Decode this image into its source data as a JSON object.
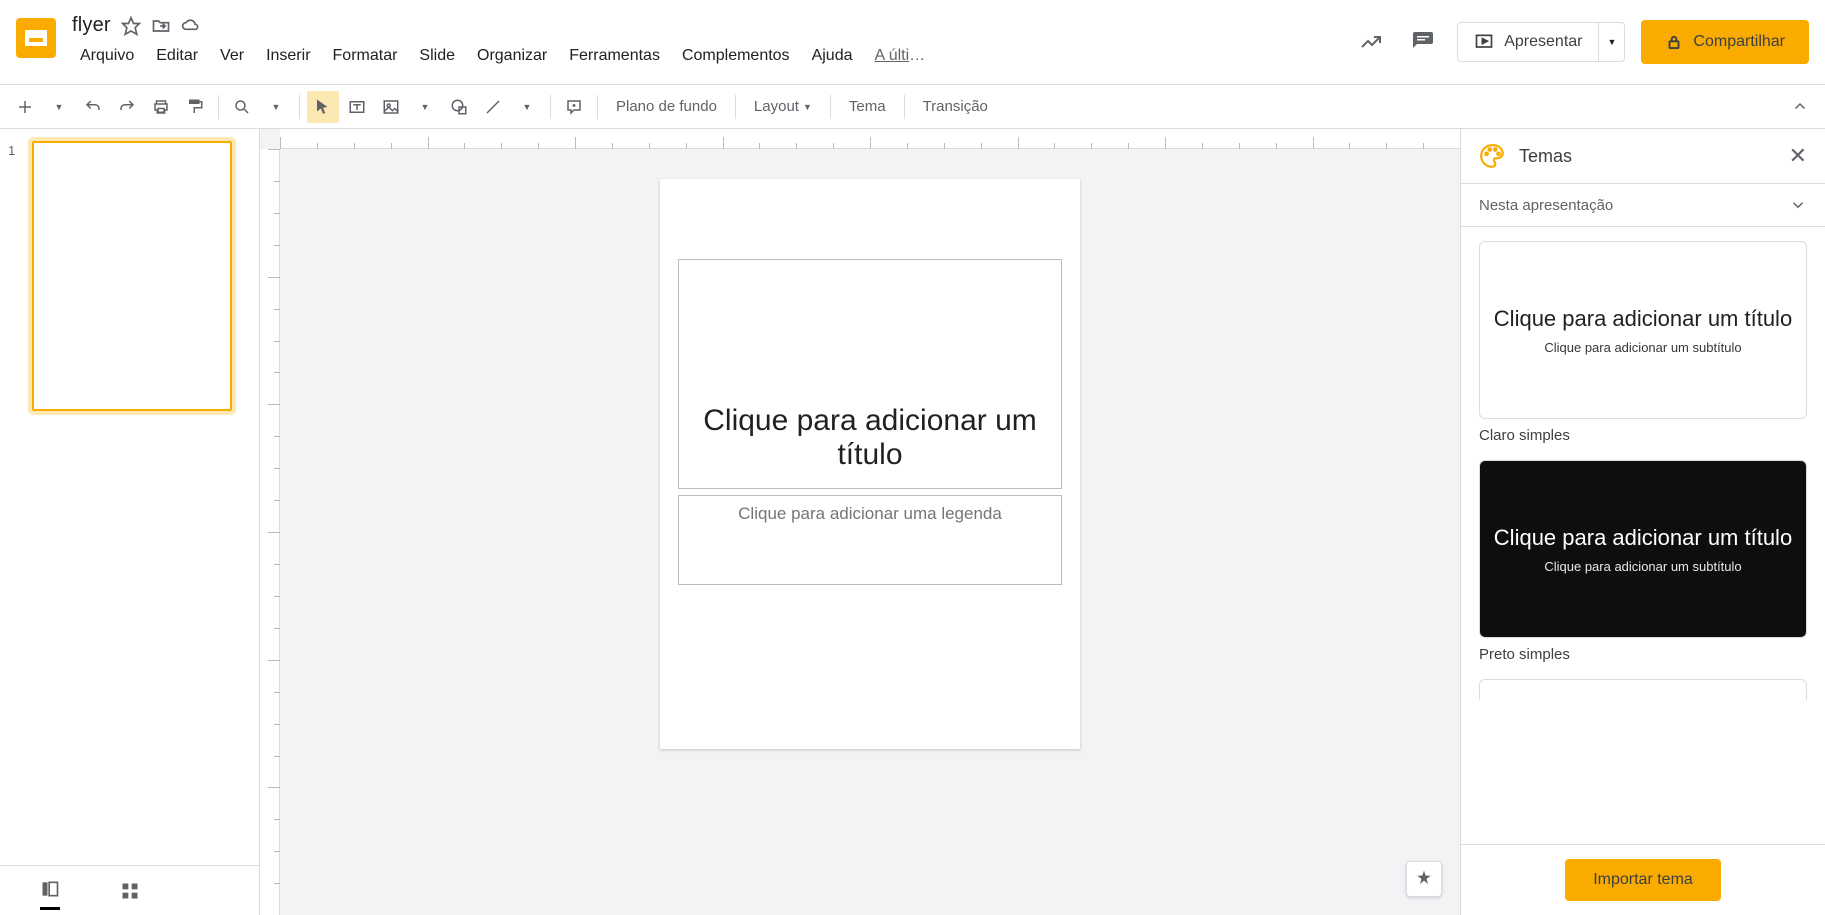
{
  "doc_title": "flyer",
  "menu": [
    "Arquivo",
    "Editar",
    "Ver",
    "Inserir",
    "Formatar",
    "Slide",
    "Organizar",
    "Ferramentas",
    "Complementos",
    "Ajuda"
  ],
  "menu_last": "A últim…",
  "present": "Apresentar",
  "share": "Compartilhar",
  "toolbar": {
    "background": "Plano de fundo",
    "layout": "Layout",
    "theme": "Tema",
    "transition": "Transição"
  },
  "slide_number": "1",
  "canvas": {
    "title_placeholder": "Clique para adicionar um título",
    "subtitle_placeholder": "Clique para adicionar uma legenda"
  },
  "themes": {
    "title": "Temas",
    "section": "Nesta apresentação",
    "import": "Importar tema",
    "items": [
      {
        "title": "Clique para adicionar um título",
        "sub": "Clique para adicionar um subtítulo",
        "label": "Claro simples",
        "dark": false
      },
      {
        "title": "Clique para adicionar um título",
        "sub": "Clique para adicionar um subtítulo",
        "label": "Preto simples",
        "dark": true
      }
    ]
  }
}
